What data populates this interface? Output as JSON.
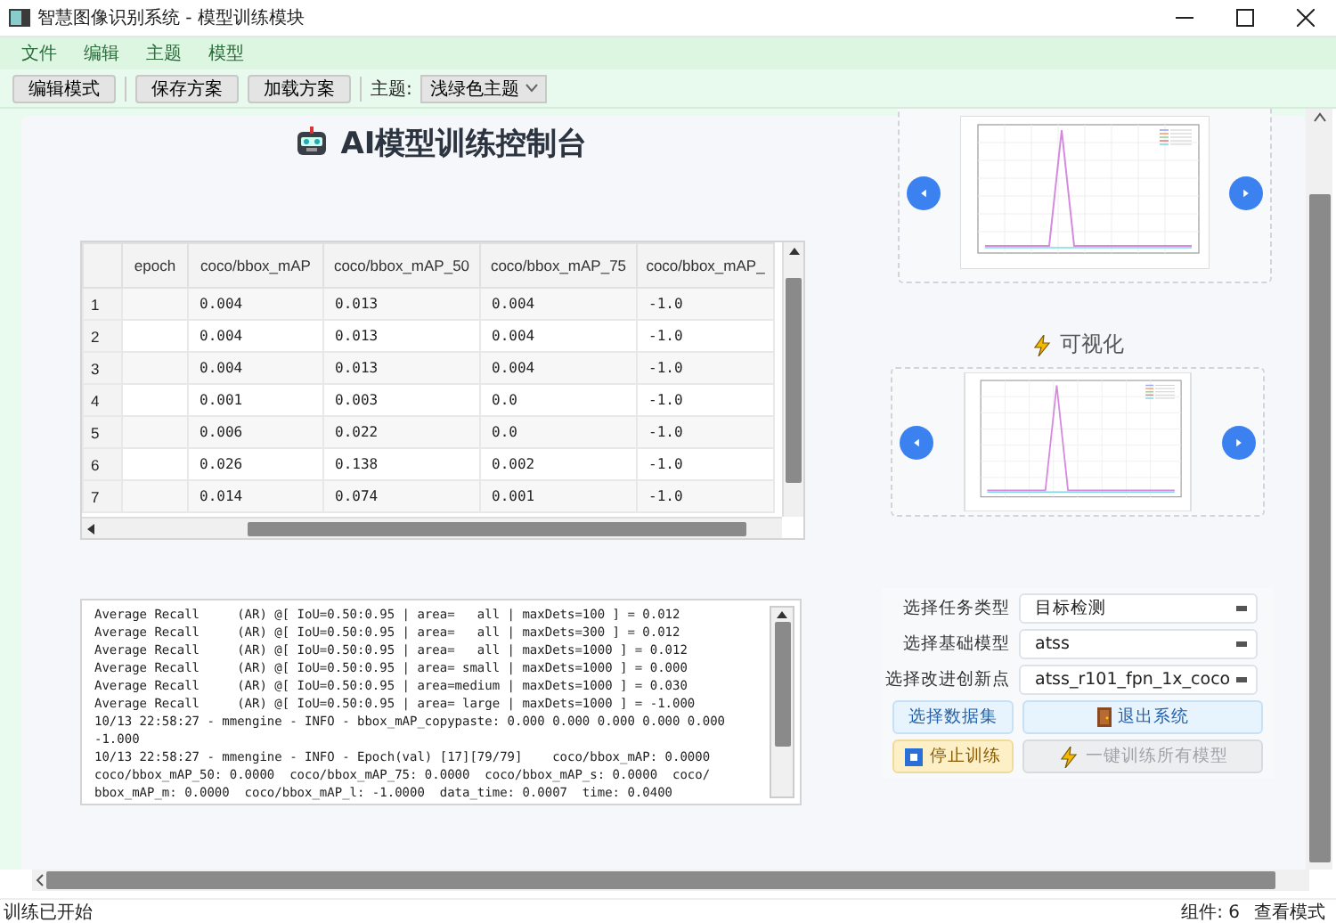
{
  "window": {
    "title": "智慧图像识别系统 - 模型训练模块"
  },
  "menu": [
    "文件",
    "编辑",
    "主题",
    "模型"
  ],
  "toolbar": {
    "buttons": [
      "编辑模式",
      "保存方案",
      "加载方案"
    ],
    "theme_label": "主题:",
    "theme_value": "浅绿色主题"
  },
  "heading": "AI模型训练控制台",
  "table": {
    "columns": [
      "epoch",
      "coco/bbox_mAP",
      "coco/bbox_mAP_50",
      "coco/bbox_mAP_75",
      "coco/bbox_mAP_"
    ],
    "rows": [
      {
        "index": "1",
        "cells": [
          "",
          "0.004",
          "0.013",
          "0.004",
          "-1.0"
        ]
      },
      {
        "index": "2",
        "cells": [
          "",
          "0.004",
          "0.013",
          "0.004",
          "-1.0"
        ]
      },
      {
        "index": "3",
        "cells": [
          "",
          "0.004",
          "0.013",
          "0.004",
          "-1.0"
        ]
      },
      {
        "index": "4",
        "cells": [
          "",
          "0.001",
          "0.003",
          "0.0",
          "-1.0"
        ]
      },
      {
        "index": "5",
        "cells": [
          "",
          "0.006",
          "0.022",
          "0.0",
          "-1.0"
        ]
      },
      {
        "index": "6",
        "cells": [
          "",
          "0.026",
          "0.138",
          "0.002",
          "-1.0"
        ]
      },
      {
        "index": "7",
        "cells": [
          "",
          "0.014",
          "0.074",
          "0.001",
          "-1.0"
        ]
      }
    ]
  },
  "log": {
    "lines": [
      "Average Recall     (AR) @[ IoU=0.50:0.95 | area=   all | maxDets=100 ] = 0.012",
      "Average Recall     (AR) @[ IoU=0.50:0.95 | area=   all | maxDets=300 ] = 0.012",
      "Average Recall     (AR) @[ IoU=0.50:0.95 | area=   all | maxDets=1000 ] = 0.012",
      "Average Recall     (AR) @[ IoU=0.50:0.95 | area= small | maxDets=1000 ] = 0.000",
      "Average Recall     (AR) @[ IoU=0.50:0.95 | area=medium | maxDets=1000 ] = 0.030",
      "Average Recall     (AR) @[ IoU=0.50:0.95 | area= large | maxDets=1000 ] = -1.000",
      "10/13 22:58:27 - mmengine - INFO - bbox_mAP_copypaste: 0.000 0.000 0.000 0.000 0.000",
      "-1.000",
      "10/13 22:58:27 - mmengine - INFO - Epoch(val) [17][79/79]    coco/bbox_mAP: 0.0000",
      "coco/bbox_mAP_50: 0.0000  coco/bbox_mAP_75: 0.0000  coco/bbox_mAP_s: 0.0000  coco/",
      "bbox_mAP_m: 0.0000  coco/bbox_mAP_l: -1.0000  data_time: 0.0007  time: 0.0400"
    ]
  },
  "visualization_heading": "可视化",
  "form": {
    "fields": [
      {
        "label": "选择任务类型",
        "value": "目标检测"
      },
      {
        "label": "选择基础模型",
        "value": "atss"
      },
      {
        "label": "选择改进创新点",
        "value": "atss_r101_fpn_1x_coco"
      }
    ],
    "buttons": [
      {
        "label": "选择数据集",
        "kind": "dataset",
        "disabled": false
      },
      {
        "label": "退出系统",
        "kind": "exit",
        "disabled": false
      },
      {
        "label": "停止训练",
        "kind": "stop",
        "disabled": false
      },
      {
        "label": "一键训练所有模型",
        "kind": "train_all",
        "disabled": true
      }
    ]
  },
  "status_bar": {
    "message": "训练已开始",
    "components": "组件: 6",
    "mode": "查看模式"
  }
}
